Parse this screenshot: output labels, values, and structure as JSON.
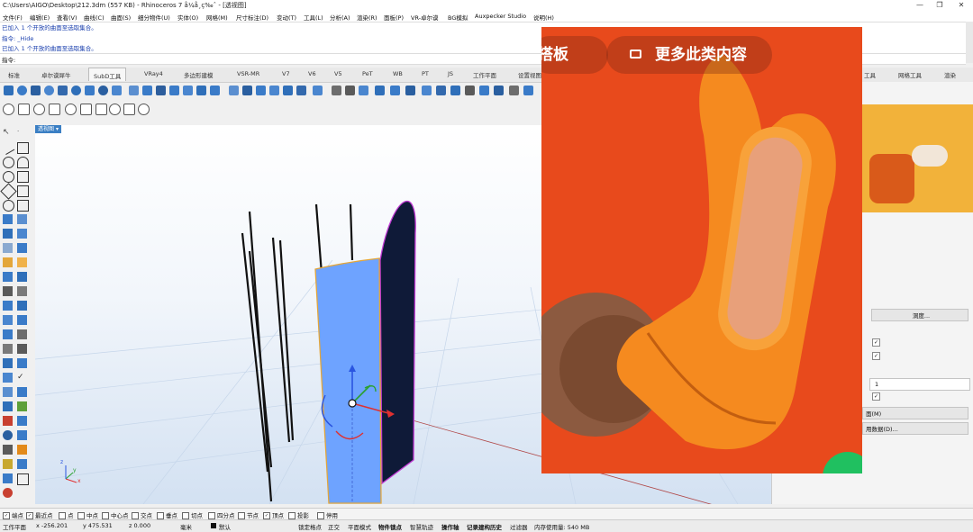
{
  "window": {
    "title": "C:\\Users\\AIGO\\Desktop\\212.3dm (557 KB) - Rhinoceros 7 å¼å¸ç‰ˆ - [透视图]",
    "controls": {
      "minimize": "—",
      "maximize": "❐",
      "close": "✕"
    }
  },
  "menu": [
    "文件(F)",
    "编辑(E)",
    "查看(V)",
    "曲线(C)",
    "曲面(S)",
    "细分物件(U)",
    "实体(O)",
    "网格(M)",
    "尺寸标注(D)",
    "变动(T)",
    "工具(L)",
    "分析(A)",
    "渲染(R)",
    "面板(P)",
    "VR-卓尔谟",
    "BG模拟",
    "Auxpecker Studio",
    "说明(H)"
  ],
  "command_history": [
    "已加入 1 个开放的曲面至选取集合。",
    "指令: _Hide",
    "已加入 1 个开放的曲面至选取集合。"
  ],
  "command_prompt": "指令:",
  "tabs": [
    "标准",
    "卓尔谟犀牛",
    "SubD工具",
    "VRay4",
    "多边形建模",
    "VSR-MR",
    "V7",
    "V6",
    "V5",
    "PeT",
    "WB",
    "PT",
    "JS",
    "工作平面",
    "设置视图"
  ],
  "active_tab_index": 2,
  "right_tabs": [
    "工具",
    "网格工具",
    "渲染"
  ],
  "viewport": {
    "label": "透视图",
    "axis_labels": {
      "x": "x",
      "y": "y",
      "z": "z"
    }
  },
  "right_panel": {
    "button_top": "洞度...",
    "spinner_value": "1",
    "btn_1": "面(M)",
    "btn_2": "用数据(D)..."
  },
  "overlay": {
    "pill_left": "搭板",
    "pill_right": "更多此类内容"
  },
  "osnap": [
    {
      "label": "端点",
      "checked": true
    },
    {
      "label": "最近点",
      "checked": true
    },
    {
      "label": "点",
      "checked": false
    },
    {
      "label": "中点",
      "checked": false
    },
    {
      "label": "中心点",
      "checked": false
    },
    {
      "label": "交点",
      "checked": false
    },
    {
      "label": "垂点",
      "checked": false
    },
    {
      "label": "切点",
      "checked": false
    },
    {
      "label": "四分点",
      "checked": false
    },
    {
      "label": "节点",
      "checked": false
    },
    {
      "label": "顶点",
      "checked": true
    },
    {
      "label": "投影",
      "checked": false
    },
    {
      "label": "停用",
      "checked": false
    }
  ],
  "status": {
    "cplane": "工作平面",
    "x": "x -256.201",
    "y": "y 475.531",
    "z": "z 0.000",
    "units": "毫米",
    "layer": "默认",
    "lock_grid": "锁定格点",
    "ortho": "正交",
    "planar": "平面模式",
    "osnap": "物件锁点",
    "smarttrack": "智慧轨迹",
    "gumball": "操作轴",
    "history": "记录建构历史",
    "filter": "过滤器",
    "memory": "内存使用量: 540 MB"
  },
  "colors": {
    "accent_blue": "#3b7fc4",
    "surface_blue": "#6ea3ff",
    "overlay_orange": "#e84a1c",
    "product_orange": "#f58a1f"
  }
}
